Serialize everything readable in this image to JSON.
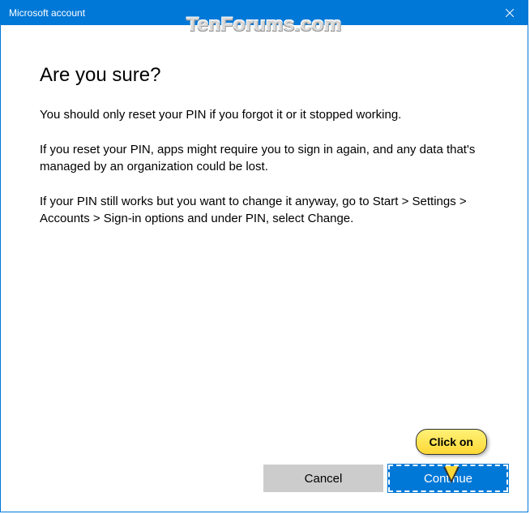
{
  "titlebar": {
    "title": "Microsoft account"
  },
  "content": {
    "heading": "Are you sure?",
    "paragraph1": "You should only reset your PIN if you forgot it or it stopped working.",
    "paragraph2": "If you reset your PIN, apps might require you to sign in again, and any data that's managed by an organization could be lost.",
    "paragraph3": "If your PIN still works but you want to change it anyway, go to Start > Settings > Accounts > Sign-in options and under PIN, select Change."
  },
  "buttons": {
    "cancel": "Cancel",
    "continue": "Continue"
  },
  "watermark": "TenForums.com",
  "callout": {
    "text": "Click on"
  }
}
